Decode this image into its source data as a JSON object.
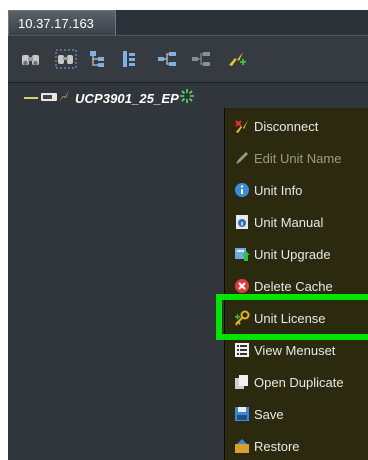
{
  "tab": {
    "label": "10.37.17.163"
  },
  "toolbar": {
    "buttons": [
      {
        "icon": "binoculars-icon"
      },
      {
        "icon": "binoculars-select-icon"
      },
      {
        "icon": "tree-expand-icon"
      },
      {
        "icon": "tree-collapse-icon"
      },
      {
        "icon": "network-icon"
      },
      {
        "icon": "network-disabled-icon"
      },
      {
        "icon": "add-unit-icon"
      }
    ]
  },
  "tree": {
    "node_label": "UCP3901_25_EP"
  },
  "context_menu": {
    "items": [
      {
        "label": "Disconnect",
        "icon": "disconnect-icon",
        "enabled": true
      },
      {
        "label": "Edit Unit Name",
        "icon": "pencil-icon",
        "enabled": false
      },
      {
        "label": "Unit Info",
        "icon": "info-icon",
        "enabled": true
      },
      {
        "label": "Unit Manual",
        "icon": "manual-icon",
        "enabled": true
      },
      {
        "label": "Unit Upgrade",
        "icon": "upgrade-icon",
        "enabled": true
      },
      {
        "label": "Delete Cache",
        "icon": "delete-icon",
        "enabled": true
      },
      {
        "label": "Unit License",
        "icon": "license-key-icon",
        "enabled": true
      },
      {
        "label": "View Menuset",
        "icon": "list-icon",
        "enabled": true
      },
      {
        "label": "Open Duplicate",
        "icon": "duplicate-icon",
        "enabled": true
      },
      {
        "label": "Save",
        "icon": "save-icon",
        "enabled": true
      },
      {
        "label": "Restore",
        "icon": "restore-icon",
        "enabled": true
      }
    ],
    "highlighted_item": "Unit License"
  },
  "colors": {
    "highlight": "#00e600",
    "menu_background": "#2b2a0e"
  }
}
